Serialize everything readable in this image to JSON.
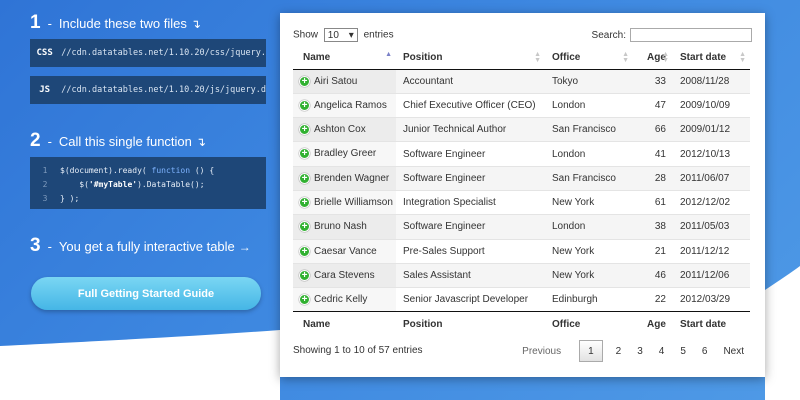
{
  "steps": [
    {
      "number": "1",
      "text": "Include these two files",
      "arrow": "↴"
    },
    {
      "number": "2",
      "text": "Call this single function",
      "arrow": "↴"
    },
    {
      "number": "3",
      "text": "You get a fully interactive table",
      "arrow": "→"
    }
  ],
  "files": {
    "css": {
      "lang": "CSS",
      "url": "//cdn.datatables.net/1.10.20/css/jquery."
    },
    "js": {
      "lang": "JS",
      "url": "//cdn.datatables.net/1.10.20/js/jquery.d"
    }
  },
  "code": {
    "l1": {
      "num": "1",
      "a": "$(document).ready( ",
      "kw": "function",
      "b": " () {"
    },
    "l2": {
      "num": "2",
      "a": "    $(",
      "str": "'#myTable'",
      "b": ").DataTable();"
    },
    "l3": {
      "num": "3",
      "a": "} );"
    }
  },
  "guide_button": "Full Getting Started Guide",
  "table_controls": {
    "show": "Show",
    "length": "10",
    "entries": "entries",
    "search_label": "Search:",
    "search_value": ""
  },
  "columns": [
    "Name",
    "Position",
    "Office",
    "Age",
    "Start date"
  ],
  "rows": [
    {
      "name": "Airi Satou",
      "position": "Accountant",
      "office": "Tokyo",
      "age": "33",
      "start": "2008/11/28"
    },
    {
      "name": "Angelica Ramos",
      "position": "Chief Executive Officer (CEO)",
      "office": "London",
      "age": "47",
      "start": "2009/10/09"
    },
    {
      "name": "Ashton Cox",
      "position": "Junior Technical Author",
      "office": "San Francisco",
      "age": "66",
      "start": "2009/01/12"
    },
    {
      "name": "Bradley Greer",
      "position": "Software Engineer",
      "office": "London",
      "age": "41",
      "start": "2012/10/13"
    },
    {
      "name": "Brenden Wagner",
      "position": "Software Engineer",
      "office": "San Francisco",
      "age": "28",
      "start": "2011/06/07"
    },
    {
      "name": "Brielle Williamson",
      "position": "Integration Specialist",
      "office": "New York",
      "age": "61",
      "start": "2012/12/02"
    },
    {
      "name": "Bruno Nash",
      "position": "Software Engineer",
      "office": "London",
      "age": "38",
      "start": "2011/05/03"
    },
    {
      "name": "Caesar Vance",
      "position": "Pre-Sales Support",
      "office": "New York",
      "age": "21",
      "start": "2011/12/12"
    },
    {
      "name": "Cara Stevens",
      "position": "Sales Assistant",
      "office": "New York",
      "age": "46",
      "start": "2011/12/06"
    },
    {
      "name": "Cedric Kelly",
      "position": "Senior Javascript Developer",
      "office": "Edinburgh",
      "age": "22",
      "start": "2012/03/29"
    }
  ],
  "info": "Showing 1 to 10 of 57 entries",
  "pagination": {
    "previous": "Previous",
    "pages": [
      "1",
      "2",
      "3",
      "4",
      "5",
      "6"
    ],
    "next": "Next"
  },
  "colors": {
    "accent": "#2f74d6",
    "code_bg": "#1e4778",
    "button": "#45b6e6",
    "expand_icon": "#31b131"
  },
  "icons": {
    "expand": "plus-circle-icon",
    "sort": "sort-arrows-icon",
    "select": "dropdown-arrow-icon"
  }
}
